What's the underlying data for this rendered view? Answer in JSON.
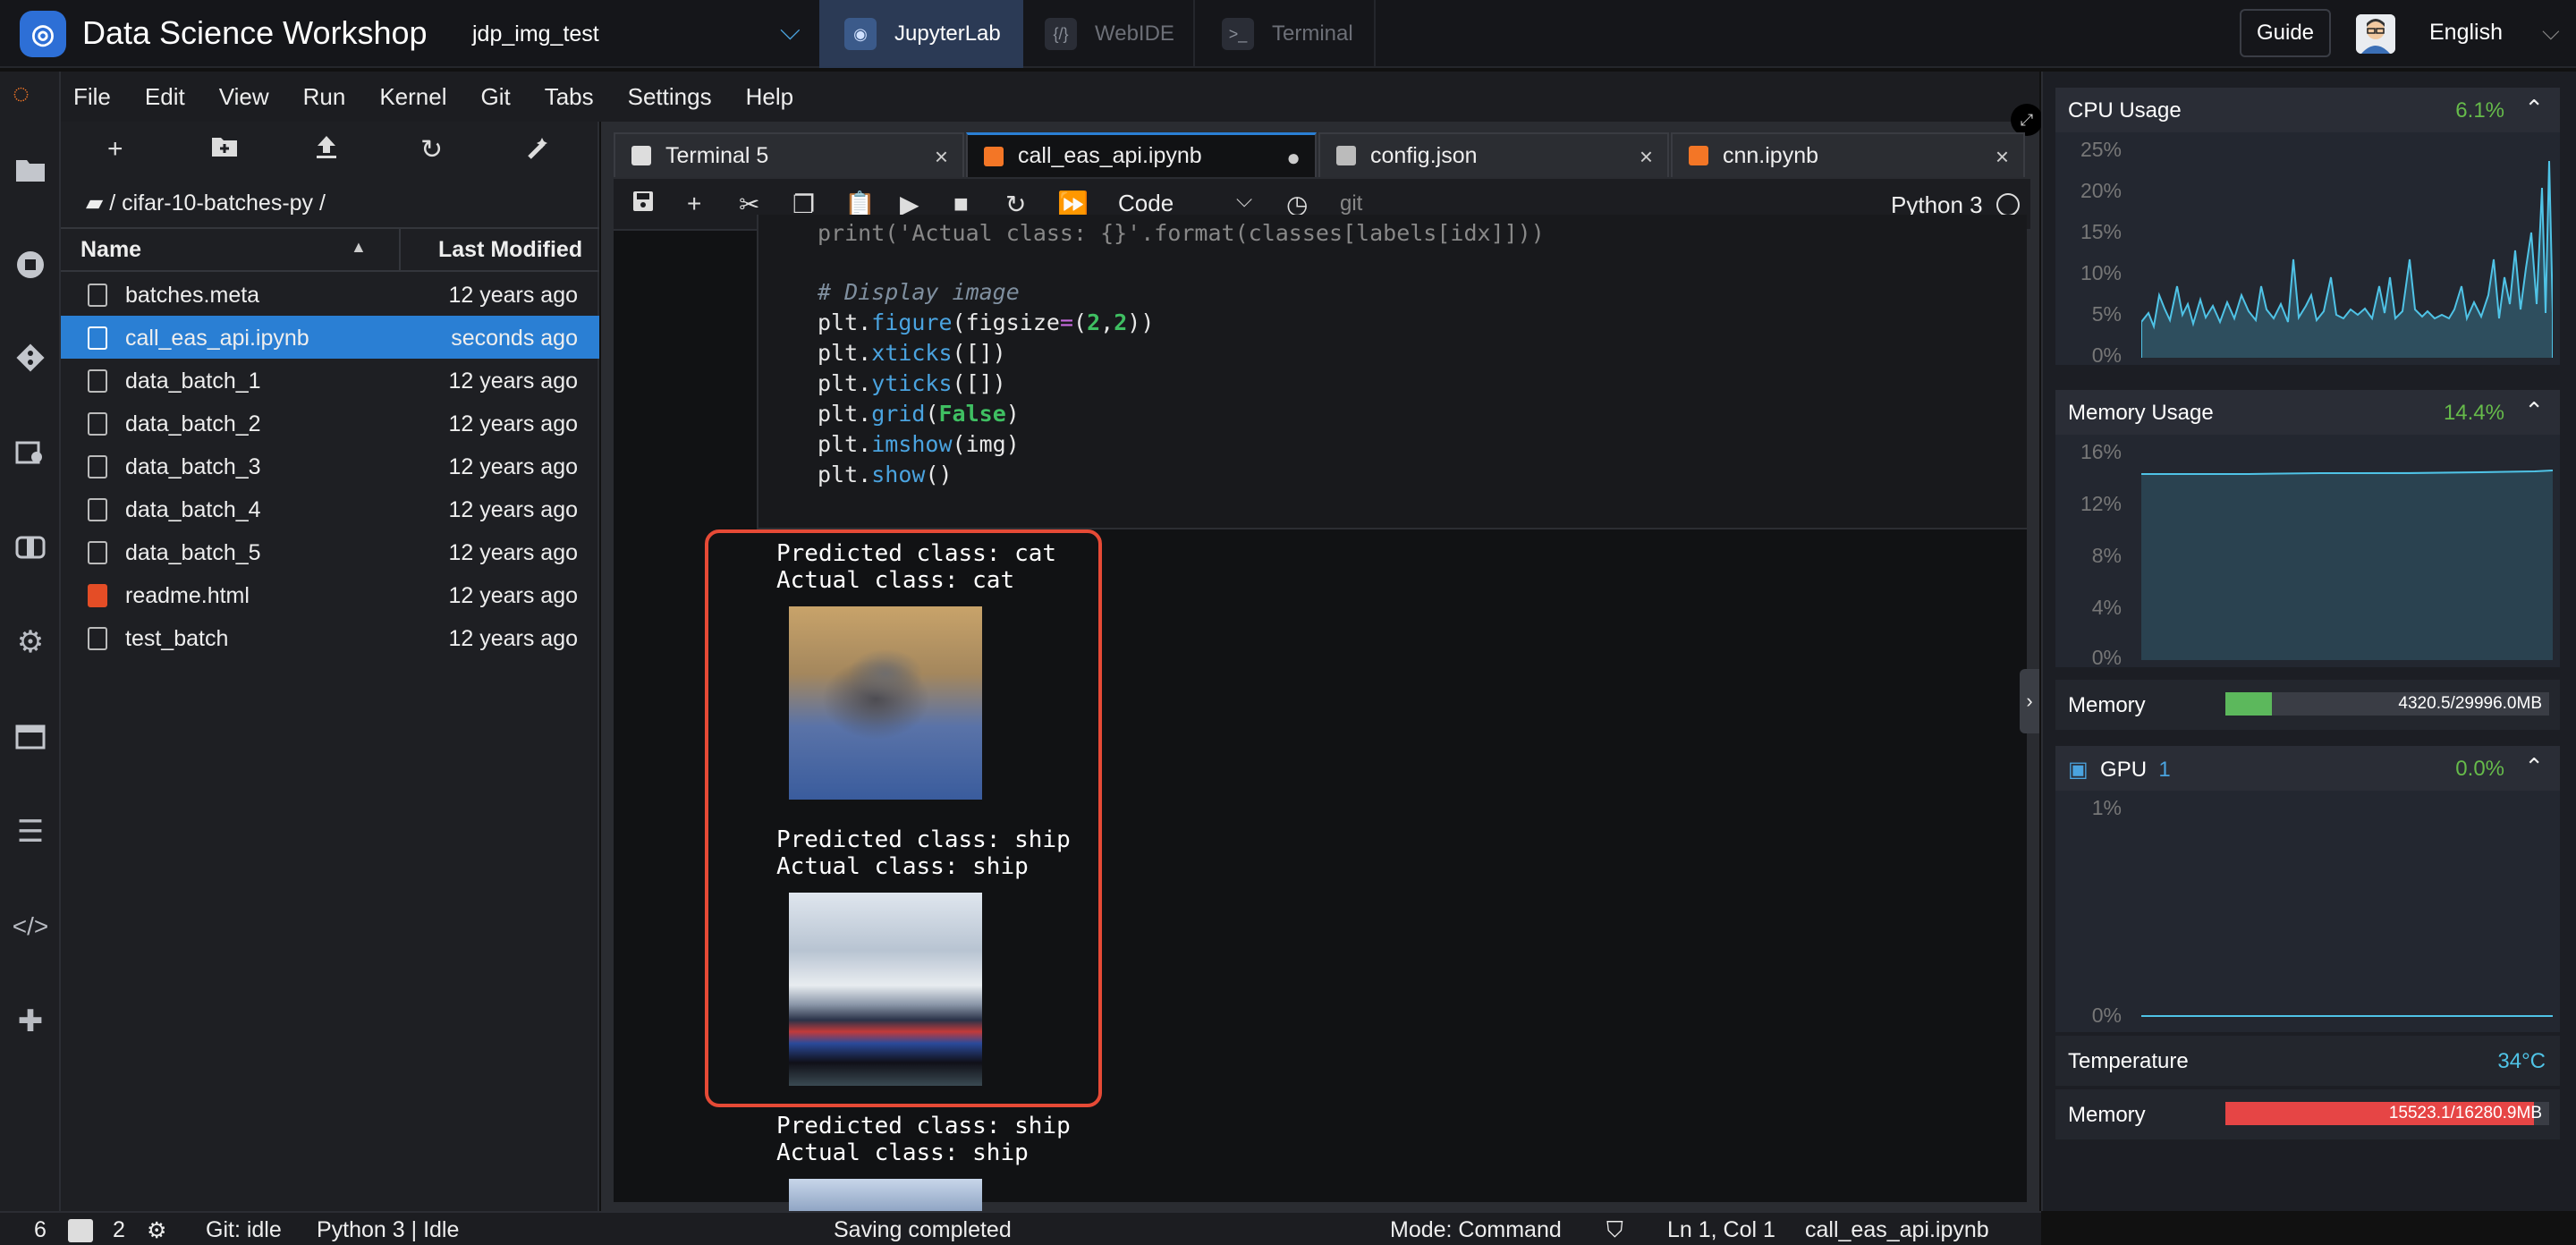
{
  "app": {
    "title": "Data Science Workshop",
    "logo": "workshop-logo-icon"
  },
  "workspace": {
    "name": "jdp_img_test"
  },
  "top_tabs": [
    {
      "label": "JupyterLab",
      "active": true
    },
    {
      "label": "WebIDE",
      "active": false
    },
    {
      "label": "Terminal",
      "active": false
    }
  ],
  "guide_label": "Guide",
  "language": "English",
  "menu": [
    "File",
    "Edit",
    "View",
    "Run",
    "Kernel",
    "Git",
    "Tabs",
    "Settings",
    "Help"
  ],
  "rail_icons": [
    "folder-icon",
    "running-icon",
    "git-icon",
    "dataset-icon",
    "package-icon",
    "settings-icon",
    "window-icon",
    "list-icon",
    "code-icon",
    "extension-icon"
  ],
  "filebrowser": {
    "breadcrumb": "/ cifar-10-batches-py /",
    "col_name": "Name",
    "col_modified": "Last Modified",
    "files": [
      {
        "name": "batches.meta",
        "modified": "12 years ago",
        "type": "file"
      },
      {
        "name": "call_eas_api.ipynb",
        "modified": "seconds ago",
        "type": "notebook",
        "selected": true
      },
      {
        "name": "data_batch_1",
        "modified": "12 years ago",
        "type": "file"
      },
      {
        "name": "data_batch_2",
        "modified": "12 years ago",
        "type": "file"
      },
      {
        "name": "data_batch_3",
        "modified": "12 years ago",
        "type": "file"
      },
      {
        "name": "data_batch_4",
        "modified": "12 years ago",
        "type": "file"
      },
      {
        "name": "data_batch_5",
        "modified": "12 years ago",
        "type": "file"
      },
      {
        "name": "readme.html",
        "modified": "12 years ago",
        "type": "html"
      },
      {
        "name": "test_batch",
        "modified": "12 years ago",
        "type": "file"
      }
    ]
  },
  "doc_tabs": [
    {
      "label": "Terminal 5",
      "active": false,
      "close": "×"
    },
    {
      "label": "call_eas_api.ipynb",
      "active": true,
      "close": "●"
    },
    {
      "label": "config.json",
      "active": false,
      "close": "×"
    },
    {
      "label": "cnn.ipynb",
      "active": false,
      "close": "×"
    }
  ],
  "toolbar": {
    "cell_type": "Code",
    "git": "git",
    "kernel": "Python 3"
  },
  "code_lines": {
    "l0": "print('Actual class: {}'.format(classes[labels[idx]]))",
    "l1": "# Display image",
    "l2a": "plt.",
    "l2b": "figure",
    "l2c": "(figsize",
    "l2d": "=",
    "l2e": "(",
    "l2f": "2",
    "l2g": ",",
    "l2h": "2",
    "l2i": "))",
    "l3a": "plt.",
    "l3b": "xticks",
    "l3c": "([])",
    "l4a": "plt.",
    "l4b": "yticks",
    "l4c": "([])",
    "l5a": "plt.",
    "l5b": "grid",
    "l5c": "(",
    "l5d": "False",
    "l5e": ")",
    "l6a": "plt.",
    "l6b": "imshow",
    "l6c": "(img)",
    "l7a": "plt.",
    "l7b": "show",
    "l7c": "()"
  },
  "outputs": [
    {
      "pred": "Predicted class: cat",
      "actual": "Actual class: cat"
    },
    {
      "pred": "Predicted class: ship",
      "actual": "Actual class: ship"
    },
    {
      "pred": "Predicted class: ship",
      "actual": "Actual class: ship"
    }
  ],
  "monitor": {
    "cpu": {
      "title": "CPU Usage",
      "value": "6.1%",
      "yticks": [
        "25%",
        "20%",
        "15%",
        "10%",
        "5%",
        "0%"
      ]
    },
    "memory": {
      "title": "Memory Usage",
      "value": "14.4%",
      "yticks": [
        "16%",
        "12%",
        "8%",
        "4%",
        "0%"
      ],
      "bar_label": "Memory",
      "bar_text": "4320.5/29996.0MB",
      "fill_fraction": 0.144
    },
    "gpu": {
      "title": "GPU",
      "count": "1",
      "value": "0.0%",
      "yticks": [
        "1%",
        "0%"
      ],
      "temp_label": "Temperature",
      "temp_value": "34°C",
      "bar_label": "Memory",
      "bar_text": "15523.1/16280.9MB",
      "fill_fraction": 0.953
    },
    "colors": {
      "cpu_line": "#4fc3e6",
      "mem_line": "#4fc3e6",
      "gpu_mem_bar": "#e64545",
      "mem_bar": "#5cb85c",
      "value_green": "#66bb4a"
    }
  },
  "status": {
    "count1": "6",
    "count2": "2",
    "git": "Git: idle",
    "kernel": "Python 3 | Idle",
    "saving": "Saving completed",
    "mode": "Mode: Command",
    "position": "Ln 1, Col 1",
    "file": "call_eas_api.ipynb"
  }
}
